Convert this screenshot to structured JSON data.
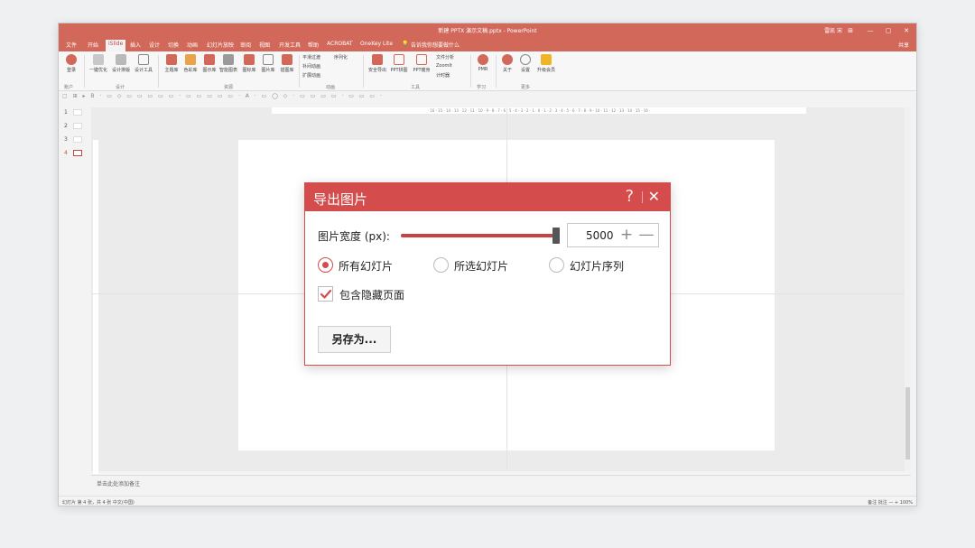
{
  "window": {
    "title": "新建 PPTX 演示文稿.pptx - PowerPoint",
    "user": "雷凯 宋",
    "buttons": {
      "ribbon_options": "⊞",
      "minimize": "—",
      "maximize": "▢",
      "close": "✕"
    }
  },
  "menu": {
    "tabs": [
      "文件",
      "开始",
      "iSlide",
      "插入",
      "设计",
      "切换",
      "动画",
      "幻灯片放映",
      "审阅",
      "视图",
      "开发工具",
      "帮助",
      "ACROBAT",
      "OneKey Lite",
      "告诉我你想要做什么"
    ],
    "active": "iSlide",
    "share": "共享"
  },
  "ribbon": {
    "items": [
      "登录",
      "一键优化",
      "设计排版",
      "设计工具",
      "主题库",
      "色彩库",
      "图示库",
      "智能图表",
      "图标库",
      "图片库",
      "插图库",
      "安全导出",
      "PPT拼图",
      "PPT瘦身",
      "PMR",
      "关于",
      "设置",
      "升级会员"
    ],
    "small_items": [
      "平滑过渡",
      "序列化",
      "补间动画",
      "扩展动画",
      "文件分析",
      "ZoomIt",
      "计时器"
    ],
    "groups": [
      "账户",
      "设计",
      "资源",
      "动画",
      "工具",
      "学习",
      "更多"
    ]
  },
  "ruler": {
    "ticks": "· 16 · 15 · 14 · 13 · 12 · 11 · 10 · 9 · 8 · 7 · 6 · 5 · 4 · 3 · 2 · 1 · 0 · 1 · 2 · 3 · 4 · 5 · 6 · 7 · 8 · 9 · 10 · 11 · 12 · 13 · 14 · 15 · 16 ·"
  },
  "thumbnails": [
    "1",
    "2",
    "3",
    "4"
  ],
  "notes_placeholder": "单击此处添加备注",
  "status": {
    "left": "幻灯片 第 4 张，共 4 张    中文(中国)",
    "right": "备注    批注    —  +  100%"
  },
  "dialog": {
    "title": "导出图片",
    "help": "?",
    "close": "✕",
    "width_label": "图片宽度 (px):",
    "width_value": "5000",
    "width_fraction": 0.97,
    "plus": "+",
    "minus": "—",
    "radios": [
      "所有幻灯片",
      "所选幻灯片",
      "幻灯片序列"
    ],
    "selected_radio": 0,
    "checkbox_label": "包含隐藏页面",
    "checkbox_checked": true,
    "save_button": "另存为..."
  },
  "colors": {
    "accent": "#d44c4c",
    "titlebar": "#d1685a"
  }
}
